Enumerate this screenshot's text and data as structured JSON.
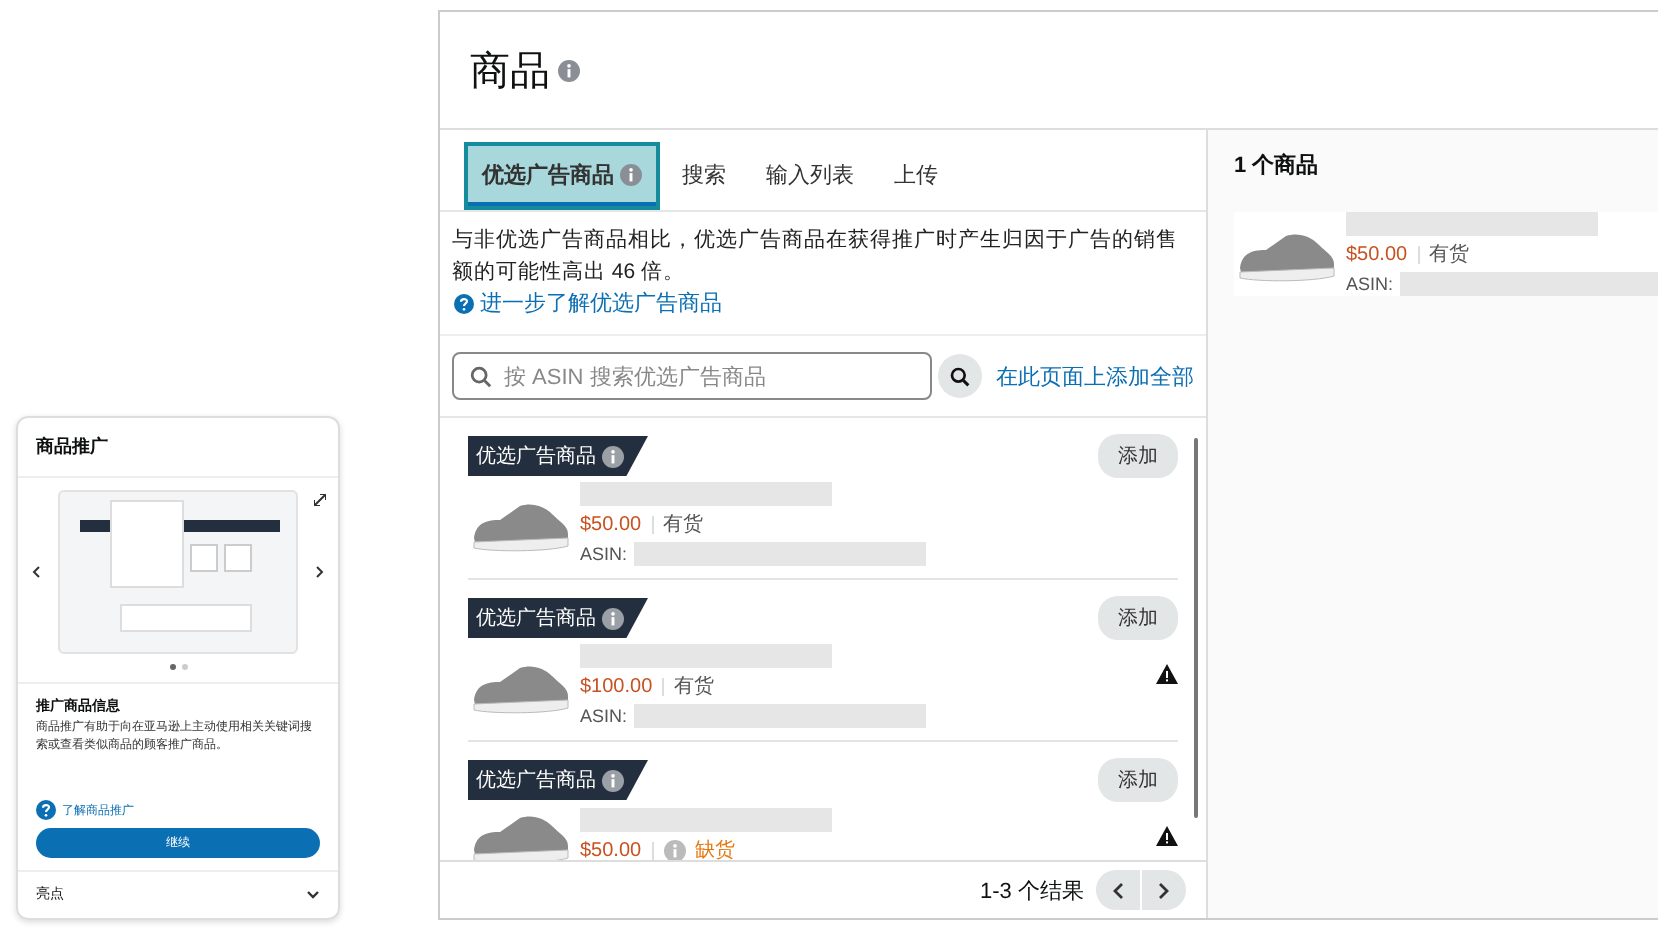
{
  "promo_card": {
    "title": "商品推广",
    "carousel": {
      "slides": [
        {
          "selected": true
        },
        {
          "selected": false
        }
      ]
    },
    "heading": "推广商品信息",
    "description": "商品推广有助于向在亚马逊上主动使用相关关键词搜索或查看类似商品的顾客推广商品。",
    "link": "了解商品推广",
    "button": "继续",
    "footer": "亮点"
  },
  "panel": {
    "title": "商品",
    "tabs": [
      {
        "label": "优选广告商品",
        "selected": true,
        "info": true
      },
      {
        "label": "搜索",
        "selected": false,
        "info": false
      },
      {
        "label": "输入列表",
        "selected": false,
        "info": false
      },
      {
        "label": "上传",
        "selected": false,
        "info": false
      }
    ],
    "notice": "与非优选广告商品相比，优选广告商品在获得推广时产生归因于广告的销售额的可能性高出 46 倍。",
    "learn_link": "进一步了解优选广告商品",
    "search": {
      "placeholder": "按 ASIN 搜索优选广告商品"
    },
    "add_all": "在此页面上添加全部",
    "items": [
      {
        "badge": "优选广告商品",
        "price": "$50.00",
        "stock": "有货",
        "out_of_stock": false,
        "asin_label": "ASIN:",
        "warning": false,
        "button": "添加"
      },
      {
        "badge": "优选广告商品",
        "price": "$100.00",
        "stock": "有货",
        "out_of_stock": false,
        "asin_label": "ASIN:",
        "warning": true,
        "button": "添加"
      },
      {
        "badge": "优选广告商品",
        "price": "$50.00",
        "stock": "缺货",
        "out_of_stock": true,
        "warning": true,
        "button": "添加"
      }
    ],
    "results": "1-3 个结果",
    "selected_count": "1 个商品",
    "selected_items": [
      {
        "price": "$50.00",
        "stock": "有货",
        "out_of_stock": false,
        "asin_label": "ASIN:"
      }
    ]
  }
}
